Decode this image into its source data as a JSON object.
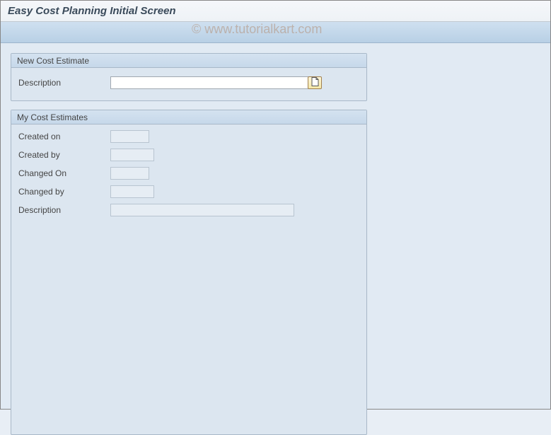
{
  "header": {
    "title": "Easy Cost Planning Initial Screen"
  },
  "watermark": "© www.tutorialkart.com",
  "new_estimate": {
    "panel_title": "New Cost Estimate",
    "description_label": "Description",
    "description_value": ""
  },
  "my_estimates": {
    "panel_title": "My Cost Estimates",
    "fields": {
      "created_on": {
        "label": "Created on",
        "value": ""
      },
      "created_by": {
        "label": "Created by",
        "value": ""
      },
      "changed_on": {
        "label": "Changed On",
        "value": ""
      },
      "changed_by": {
        "label": "Changed by",
        "value": ""
      },
      "description": {
        "label": "Description",
        "value": ""
      }
    }
  }
}
